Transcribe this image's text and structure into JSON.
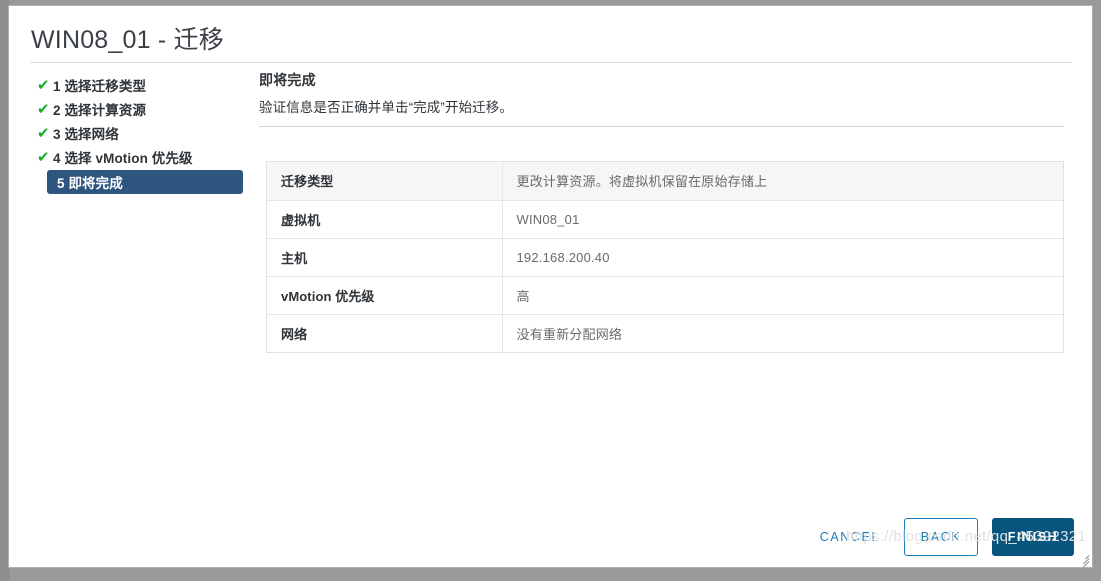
{
  "window": {
    "title": "WIN08_01 - 迁移"
  },
  "steps": [
    {
      "number": "1",
      "label": "1 选择迁移类型",
      "state": "complete",
      "check": "✔"
    },
    {
      "number": "2",
      "label": "2 选择计算资源",
      "state": "complete",
      "check": "✔"
    },
    {
      "number": "3",
      "label": "3 选择网络",
      "state": "complete",
      "check": "✔"
    },
    {
      "number": "4",
      "label": "4 选择 vMotion 优先级",
      "state": "complete",
      "check": "✔"
    },
    {
      "number": "5",
      "label": "5 即将完成",
      "state": "active",
      "check": ""
    }
  ],
  "content": {
    "title": "即将完成",
    "description": "验证信息是否正确并单击“完成”开始迁移。"
  },
  "summary": {
    "rows": [
      {
        "key": "迁移类型",
        "value": "更改计算资源。将虚拟机保留在原始存储上",
        "shaded": true
      },
      {
        "key": "虚拟机",
        "value": "WIN08_01",
        "shaded": false
      },
      {
        "key": "主机",
        "value": "192.168.200.40",
        "shaded": false
      },
      {
        "key": "vMotion 优先级",
        "value": "高",
        "shaded": false
      },
      {
        "key": "网络",
        "value": "没有重新分配网络",
        "shaded": false
      }
    ]
  },
  "footer": {
    "cancel_label": "CANCEL",
    "back_label": "BACK",
    "finish_label": "FINISH"
  },
  "watermark": {
    "text": "https://blog.csdn.net/qq_45392321"
  },
  "colors": {
    "active_step": "#2d5580",
    "check_green": "#1faa2b",
    "link_blue": "#1b7cb8",
    "primary_blue": "#07547d",
    "row_shade": "#f6f6f6",
    "text_dark": "#2f3439",
    "text_muted": "#6a6a6a"
  }
}
